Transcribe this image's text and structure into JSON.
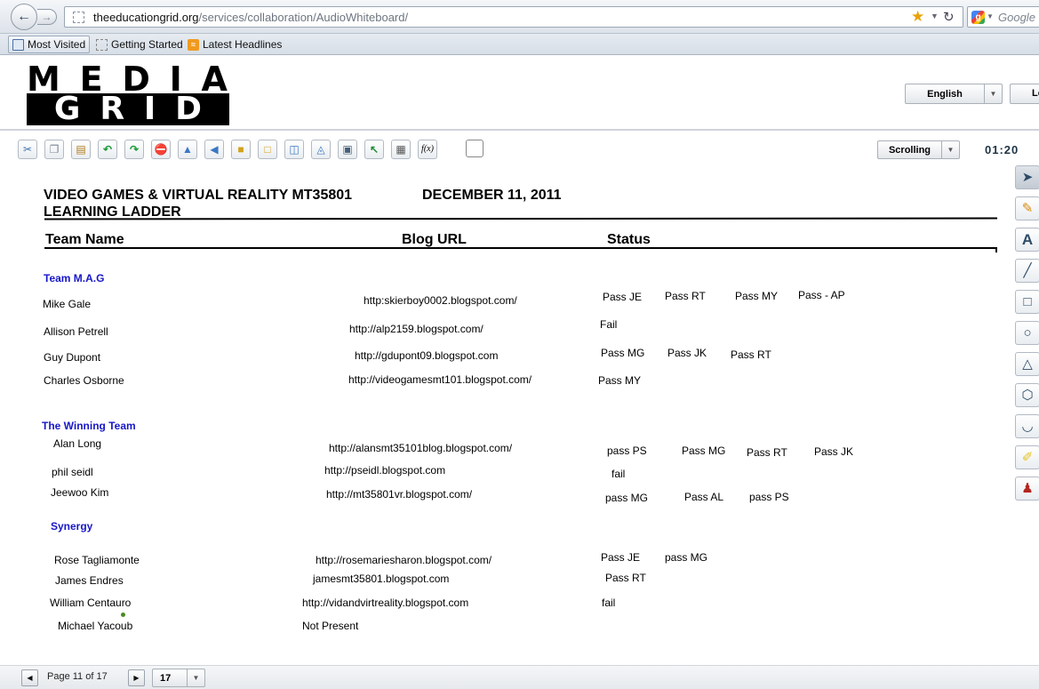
{
  "browser": {
    "url_host": "theeducationgrid.org",
    "url_path": "/services/collaboration/AudioWhiteboard/",
    "search_placeholder": "Google",
    "bookmarks": [
      "Most Visited",
      "Getting Started",
      "Latest Headlines"
    ]
  },
  "header": {
    "logo_top": [
      "M",
      "E",
      "D",
      "I",
      "A"
    ],
    "logo_bottom": [
      "G",
      "R",
      "I",
      "D"
    ],
    "language": "English",
    "logout_label": "Lo"
  },
  "toolbar": {
    "tools": [
      "cut-icon",
      "copy-icon",
      "paste-icon",
      "undo-icon",
      "redo-icon",
      "delete-icon",
      "flip-icon",
      "back-icon",
      "lock-icon",
      "unlock-icon",
      "import-icon",
      "export-icon",
      "screenshot-icon",
      "pointer-arrow-icon",
      "grid-icon",
      "formula-icon",
      "background-icon"
    ],
    "formula_label": "f(x)",
    "scroll_mode": "Scrolling",
    "timer": "01:20"
  },
  "side_tools": [
    "select-icon",
    "pencil-icon",
    "text-icon",
    "line-icon",
    "rectangle-icon",
    "circle-icon",
    "triangle-icon",
    "hexagon-icon",
    "eraser-icon",
    "highlighter-icon",
    "stamp-icon"
  ],
  "document": {
    "title_line1": "VIDEO GAMES & VIRTUAL REALITY MT35801",
    "date": "DECEMBER 11, 2011",
    "title_line2": "LEARNING LADDER",
    "col_team": "Team Name",
    "col_blog": "Blog URL",
    "col_status": "Status",
    "teams": [
      {
        "name": "Team M.A.G",
        "members": [
          {
            "name": "Mike Gale",
            "url": "http:skierboy0002.blogspot.com/",
            "status": [
              "Pass JE",
              "Pass RT",
              "Pass MY",
              "Pass - AP"
            ]
          },
          {
            "name": "Allison Petrell",
            "url": "http://alp2159.blogspot.com/",
            "status": [
              "Fail"
            ]
          },
          {
            "name": "Guy Dupont",
            "url": "http://gdupont09.blogspot.com",
            "status": [
              "Pass MG",
              "Pass JK",
              "Pass RT"
            ]
          },
          {
            "name": "Charles Osborne",
            "url": "http://videogamesmt101.blogspot.com/",
            "status": [
              "Pass MY"
            ]
          }
        ]
      },
      {
        "name": "The Winning Team",
        "members": [
          {
            "name": "Alan Long",
            "url": "http://alansmt35101blog.blogspot.com/",
            "status": [
              "pass PS",
              "Pass MG",
              "Pass RT",
              "Pass JK"
            ]
          },
          {
            "name": "phil seidl",
            "url": "http://pseidl.blogspot.com",
            "status": [
              "fail"
            ]
          },
          {
            "name": "Jeewoo Kim",
            "url": "http://mt35801vr.blogspot.com/",
            "status": [
              "pass MG",
              "Pass AL",
              "pass PS"
            ]
          }
        ]
      },
      {
        "name": "Synergy",
        "members": [
          {
            "name": "Rose Tagliamonte",
            "url": "http://rosemariesharon.blogspot.com/",
            "status": [
              "Pass JE",
              "pass MG"
            ]
          },
          {
            "name": "James Endres",
            "url": "jamesmt35801.blogspot.com",
            "status": [
              "Pass RT"
            ]
          },
          {
            "name": "William Centauro",
            "url": "http://vidandvirtreality.blogspot.com",
            "status": [
              "fail"
            ]
          },
          {
            "name": "Michael Yacoub",
            "url": "Not Present",
            "status": []
          }
        ]
      }
    ]
  },
  "pager": {
    "page_label": "Page 11 of 17",
    "page_select": "17"
  }
}
